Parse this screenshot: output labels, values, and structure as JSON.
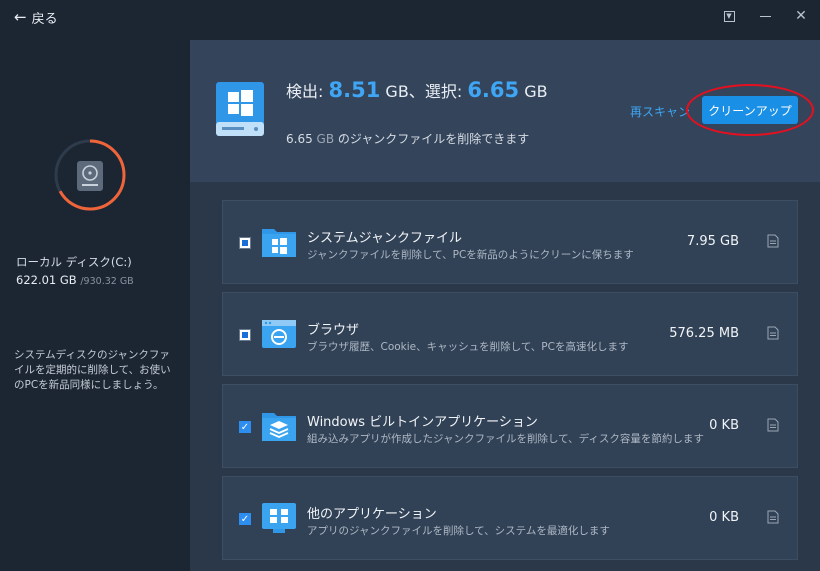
{
  "titlebar": {
    "back_label": "戻る"
  },
  "sidebar": {
    "disk_name": "ローカル ディスク(C:)",
    "used": "622.01 GB",
    "total": "/930.32 GB",
    "used_fraction": 0.67,
    "description": "システムディスクのジャンクファイルを定期的に削除して、お使いのPCを新品同様にしましょう。"
  },
  "header": {
    "detect_label": "検出:",
    "detect_value": "8.51",
    "detect_unit": "GB、",
    "select_label": "選択:",
    "select_value": "6.65",
    "select_unit": "GB",
    "deletable_value": "6.65",
    "deletable_unit": "GB",
    "deletable_text": "のジャンクファイルを削除できます",
    "rescan_label": "再スキャン",
    "cleanup_label": "クリーンアップ"
  },
  "items": [
    {
      "title": "システムジャンクファイル",
      "desc": "ジャンクファイルを削除して、PCを新品のようにクリーンに保ちます",
      "size": "7.95 GB",
      "check": "partial",
      "icon": "windows-folder-icon"
    },
    {
      "title": "ブラウザ",
      "desc": "ブラウザ履歴、Cookie、キャッシュを削除して、PCを高速化します",
      "size": "576.25 MB",
      "check": "partial",
      "icon": "browser-icon"
    },
    {
      "title": "Windows ビルトインアプリケーション",
      "desc": "組み込みアプリが作成したジャンクファイルを削除して、ディスク容量を節約します",
      "size": "0 KB",
      "check": "checked",
      "icon": "layers-folder-icon"
    },
    {
      "title": "他のアプリケーション",
      "desc": "アプリのジャンクファイルを削除して、システムを最適化します",
      "size": "0 KB",
      "check": "checked",
      "icon": "apps-window-icon"
    }
  ],
  "colors": {
    "accent": "#3ea6f4",
    "button": "#1a8fe6",
    "ring_progress": "#f0643a",
    "highlight_circle": "#e5101f"
  }
}
